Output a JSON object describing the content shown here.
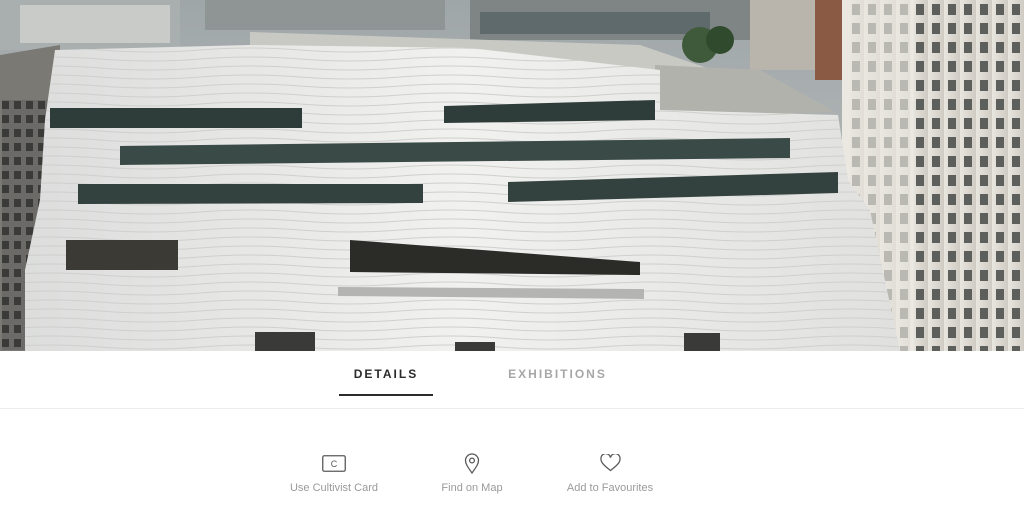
{
  "hero": {
    "image": "museum-building-photo"
  },
  "tabs": [
    {
      "label": "DETAILS",
      "active": true
    },
    {
      "label": "EXHIBITIONS",
      "active": false
    }
  ],
  "actions": [
    {
      "label": "Use Cultivist Card",
      "icon": "cultivist-card-icon",
      "icon_text": "C"
    },
    {
      "label": "Find on Map",
      "icon": "map-pin-icon"
    },
    {
      "label": "Add to Favourites",
      "icon": "heart-icon"
    }
  ],
  "colors": {
    "active_tab": "#2b2b2b",
    "inactive_tab": "#a7a7a7",
    "action_label": "#9a9a9a",
    "icon_stroke": "#5a5a5a"
  }
}
